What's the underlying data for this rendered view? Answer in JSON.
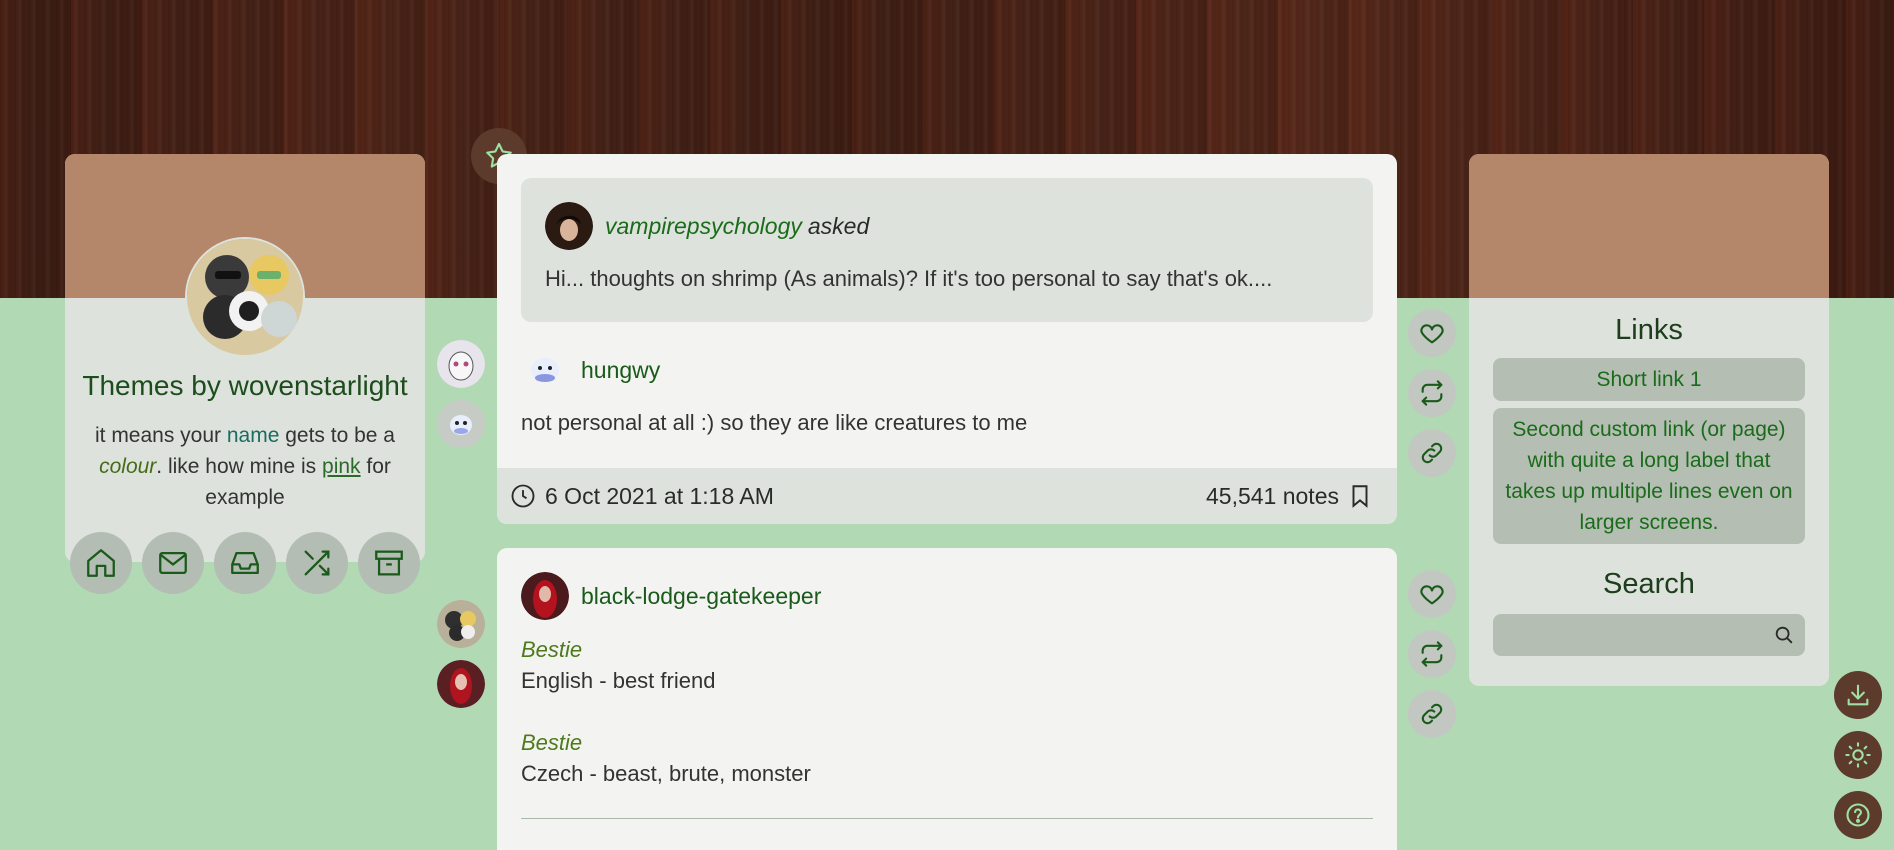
{
  "sidebar": {
    "title": "Themes by wovenstarlight",
    "desc_1": "it means your ",
    "desc_name": "name",
    "desc_2": " gets to be a ",
    "desc_colour": "colour",
    "desc_3": ". like how mine is ",
    "desc_pink": "pink",
    "desc_4": " for example",
    "nav_icons": [
      "home-icon",
      "mail-icon",
      "inbox-icon",
      "shuffle-icon",
      "archive-icon"
    ]
  },
  "post1": {
    "asker": "vampirepsychology",
    "asked_label": "asked",
    "question": "Hi... thoughts on shrimp (As animals)? If it's too personal to say that's ok....",
    "answerer": "hungwy",
    "answer": "not personal at all :) so they are like creatures to me",
    "date": "6 Oct 2021 at 1:18 AM",
    "notes": "45,541 notes"
  },
  "post2": {
    "user": "black-lodge-gatekeeper",
    "word1": "Bestie",
    "def1": "English - best friend",
    "word2": "Bestie",
    "def2": "Czech - beast, brute, monster"
  },
  "right": {
    "links_heading": "Links",
    "link1": "Short link 1",
    "link2": "Second custom link (or page) with quite a long label that takes up multiple lines even on larger screens.",
    "search_heading": "Search",
    "search_placeholder": ""
  },
  "colors": {
    "accent": "#1a6b1a",
    "wood": "#3d1f15",
    "background": "#b1d9b4",
    "header_tan": "#b5876a",
    "util_button": "#5c3a2c"
  }
}
